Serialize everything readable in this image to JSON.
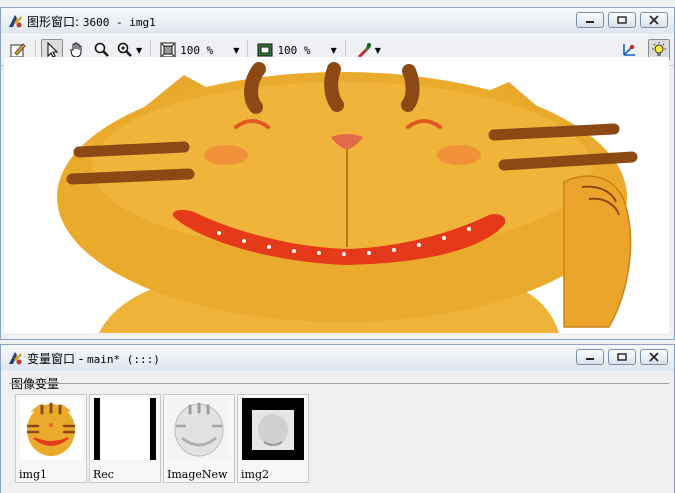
{
  "graphics_window": {
    "title_prefix": "图形窗口: ",
    "title_suffix": "3600 - img1",
    "zoom_left": "100 %",
    "zoom_right": "100 %"
  },
  "variable_window": {
    "title_prefix": "变量窗口 - ",
    "title_suffix": "main* (:::)",
    "section_label": "图像变量",
    "items": [
      {
        "label": "img1"
      },
      {
        "label": "Rec"
      },
      {
        "label": "ImageNew"
      },
      {
        "label": "img2"
      }
    ]
  },
  "colors": {
    "cat_yellow": "#eaaa2b",
    "stripe_brown": "#8b4a14",
    "mouth_red": "#e53a1a",
    "cheek_orange": "#f08a3a"
  },
  "icons": [
    "app-icon",
    "edit-icon",
    "select-arrow-icon",
    "hand-pan-icon",
    "magnifier-icon",
    "zoom-in-icon",
    "fit-window-icon",
    "fit-image-icon",
    "color-picker-icon",
    "axis-icon",
    "bulb-icon",
    "minimize-icon",
    "restore-icon",
    "close-icon"
  ]
}
